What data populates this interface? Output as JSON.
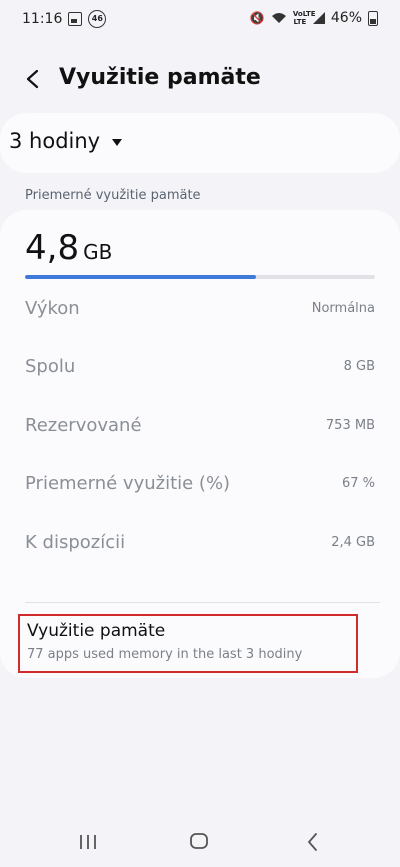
{
  "status_bar": {
    "time": "11:16",
    "badge": "46",
    "battery": "46%",
    "lte": "VoLTE LTE"
  },
  "header": {
    "title": "Využitie pamäte"
  },
  "range_selector": {
    "value": "3 hodiny"
  },
  "section": {
    "label": "Priemerné využitie pamäte"
  },
  "summary": {
    "value": "4,8",
    "unit": "GB",
    "progress": 0.66
  },
  "stats": [
    {
      "label": "Výkon",
      "value": "Normálna"
    },
    {
      "label": "Spolu",
      "value": "8 GB"
    },
    {
      "label": "Rezervované",
      "value": "753 MB"
    },
    {
      "label": "Priemerné využitie (%)",
      "value": "67 %"
    },
    {
      "label": "K dispozícii",
      "value": "2,4 GB"
    }
  ],
  "usage_link": {
    "title": "Využitie pamäte",
    "subtitle": "77 apps used memory in the last 3 hodiny"
  },
  "colors": {
    "accent": "#3e7ad9",
    "highlight_border": "#d12b2b",
    "background": "#f4f4f8",
    "card": "#fbfbfe"
  }
}
